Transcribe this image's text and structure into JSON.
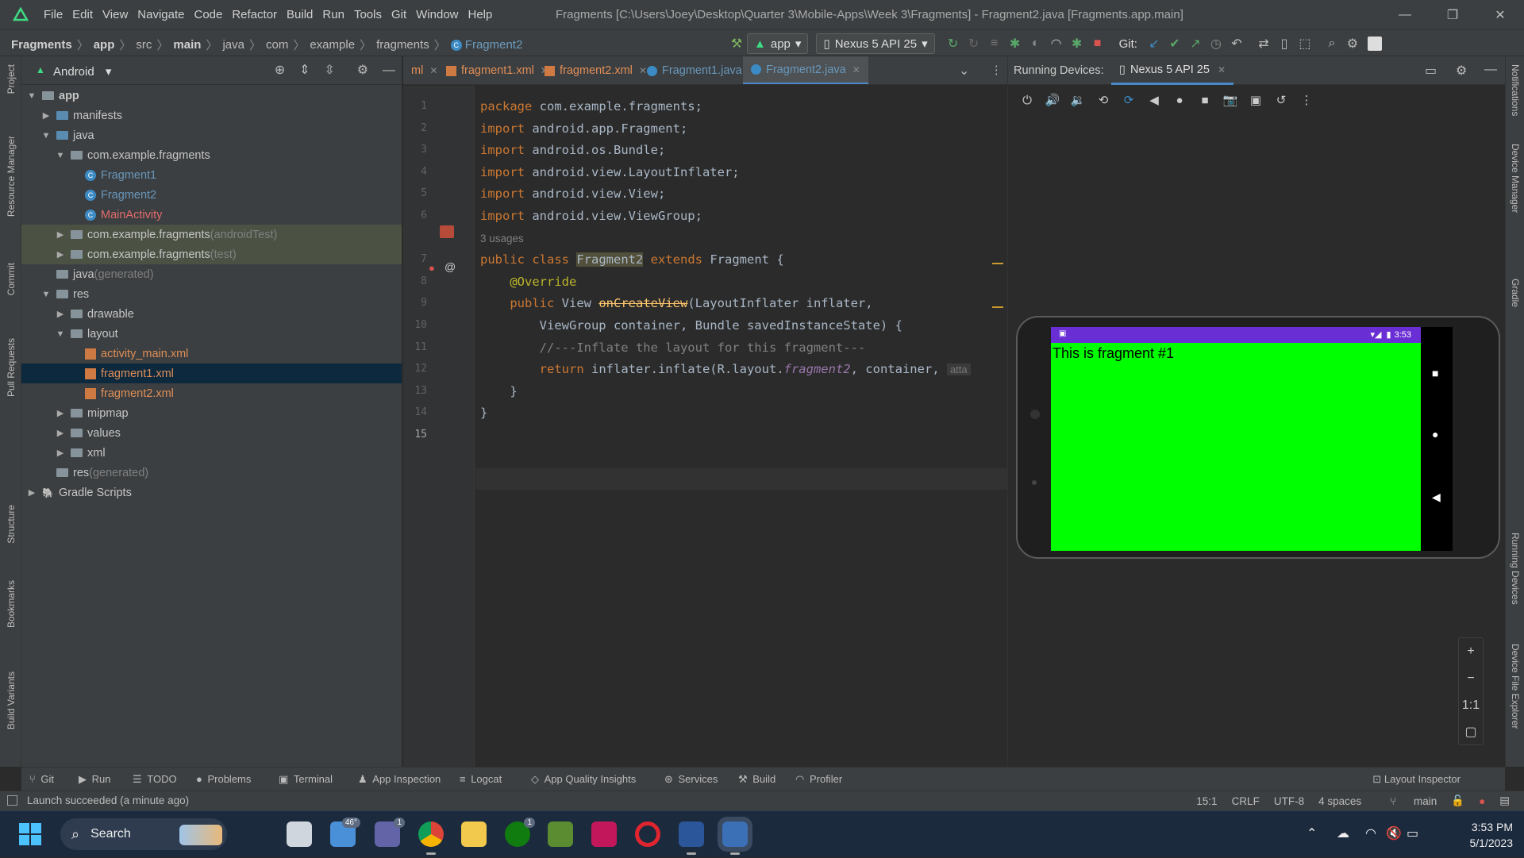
{
  "menu": [
    "File",
    "Edit",
    "View",
    "Navigate",
    "Code",
    "Refactor",
    "Build",
    "Run",
    "Tools",
    "Git",
    "Window",
    "Help"
  ],
  "window_title": "Fragments [C:\\Users\\Joey\\Desktop\\Quarter 3\\Mobile-Apps\\Week 3\\Fragments] - Fragment2.java [Fragments.app.main]",
  "breadcrumbs": [
    "Fragments",
    "app",
    "src",
    "main",
    "java",
    "com",
    "example",
    "fragments",
    "Fragment2"
  ],
  "toolbar": {
    "run_config": "app",
    "device": "Nexus 5 API 25",
    "git_label": "Git:"
  },
  "project_panel": {
    "title": "Android"
  },
  "tree": [
    {
      "label": "app",
      "depth": 0,
      "arrow": "open",
      "icon": "module",
      "bold": true
    },
    {
      "label": "manifests",
      "depth": 1,
      "arrow": "closed",
      "icon": "folder-blue"
    },
    {
      "label": "java",
      "depth": 1,
      "arrow": "open",
      "icon": "folder-blue"
    },
    {
      "label": "com.example.fragments",
      "depth": 2,
      "arrow": "open",
      "icon": "package"
    },
    {
      "label": "Fragment1",
      "depth": 3,
      "icon": "class",
      "color": "java"
    },
    {
      "label": "Fragment2",
      "depth": 3,
      "icon": "class",
      "color": "java"
    },
    {
      "label": "MainActivity",
      "depth": 3,
      "icon": "class",
      "color": "err"
    },
    {
      "label": "com.example.fragments",
      "suffix": " (androidTest)",
      "depth": 2,
      "arrow": "closed",
      "icon": "package",
      "hl": true
    },
    {
      "label": "com.example.fragments",
      "suffix": " (test)",
      "depth": 2,
      "arrow": "closed",
      "icon": "package",
      "hl": true
    },
    {
      "label": "java",
      "suffix": " (generated)",
      "depth": 1,
      "icon": "folder"
    },
    {
      "label": "res",
      "depth": 1,
      "arrow": "open",
      "icon": "folder"
    },
    {
      "label": "drawable",
      "depth": 2,
      "arrow": "closed",
      "icon": "folder"
    },
    {
      "label": "layout",
      "depth": 2,
      "arrow": "open",
      "icon": "folder"
    },
    {
      "label": "activity_main.xml",
      "depth": 3,
      "icon": "xml",
      "color": "xml"
    },
    {
      "label": "fragment1.xml",
      "depth": 3,
      "icon": "xml",
      "color": "xml",
      "sel": true
    },
    {
      "label": "fragment2.xml",
      "depth": 3,
      "icon": "xml",
      "color": "xml"
    },
    {
      "label": "mipmap",
      "depth": 2,
      "arrow": "closed",
      "icon": "folder"
    },
    {
      "label": "values",
      "depth": 2,
      "arrow": "closed",
      "icon": "folder"
    },
    {
      "label": "xml",
      "depth": 2,
      "arrow": "closed",
      "icon": "folder"
    },
    {
      "label": "res",
      "suffix": " (generated)",
      "depth": 1,
      "icon": "folder"
    },
    {
      "label": "Gradle Scripts",
      "depth": 0,
      "arrow": "closed",
      "icon": "gradle"
    }
  ],
  "editor_tabs": [
    {
      "label": "ml",
      "type": "xml"
    },
    {
      "label": "fragment1.xml",
      "type": "xml"
    },
    {
      "label": "fragment2.xml",
      "type": "xml"
    },
    {
      "label": "Fragment1.java",
      "type": "java"
    },
    {
      "label": "Fragment2.java",
      "type": "java",
      "active": true
    }
  ],
  "warnings": "2",
  "code_lines": [
    {
      "n": "1",
      "html": "<span class='kw'>package</span> com.example.fragments;"
    },
    {
      "n": "2",
      "html": "<span class='kw'>import</span> android.app.Fragment;"
    },
    {
      "n": "3",
      "html": "<span class='kw'>import</span> android.os.Bundle;"
    },
    {
      "n": "4",
      "html": "<span class='kw'>import</span> android.view.LayoutInflater;"
    },
    {
      "n": "5",
      "html": "<span class='kw'>import</span> android.view.View;"
    },
    {
      "n": "6",
      "html": "<span class='kw'>import</span> android.view.ViewGroup;"
    },
    {
      "n": "",
      "html": "<span class='usages'>3 usages</span>"
    },
    {
      "n": "7",
      "html": "<span class='kw'>public class</span> <span class='hlw'>Fragment2</span> <span class='kw'>extends</span> Fragment {"
    },
    {
      "n": "8",
      "html": "    <span class='an'>@Override</span>"
    },
    {
      "n": "9",
      "html": "    <span class='kw'>public</span> View <span class='strike'>onCreateView</span>(LayoutInflater inflater,"
    },
    {
      "n": "10",
      "html": "        ViewGroup container, Bundle savedInstanceState) {"
    },
    {
      "n": "11",
      "html": "        <span class='cm'>//---Inflate the layout for this fragment---</span>"
    },
    {
      "n": "12",
      "html": "        <span class='kw'>return</span> inflater.inflate(R.layout.<span class='it'>fragment2</span>, container, <span class='hint'>atta</span>"
    },
    {
      "n": "13",
      "html": "    }"
    },
    {
      "n": "14",
      "html": "}"
    },
    {
      "n": "15",
      "html": ""
    }
  ],
  "devices_panel": {
    "label": "Running Devices:",
    "tab": "Nexus 5 API 25"
  },
  "emulator": {
    "status_time": "3:53",
    "fragment_text": "This is fragment #1"
  },
  "zoom_controls": [
    "+",
    "−",
    "1:1",
    "▢"
  ],
  "left_strip": [
    "Project",
    "Resource Manager",
    "Commit",
    "Pull Requests",
    "Structure",
    "Bookmarks",
    "Build Variants"
  ],
  "right_strip": [
    "Notifications",
    "Device Manager",
    "Gradle",
    "Running Devices",
    "Device File Explorer"
  ],
  "bottom_tabs": [
    "Git",
    "Run",
    "TODO",
    "Problems",
    "Terminal",
    "App Inspection",
    "Logcat",
    "App Quality Insights",
    "Services",
    "Build",
    "Profiler"
  ],
  "layout_inspector": "Layout Inspector",
  "statusbar": {
    "message": "Launch succeeded (a minute ago)",
    "position": "15:1",
    "line_sep": "CRLF",
    "encoding": "UTF-8",
    "indent": "4 spaces",
    "branch": "main"
  },
  "taskbar": {
    "search_label": "Search",
    "weather_badge": "46°",
    "teams_badge": "1",
    "xbox_badge": "1",
    "time": "3:53 PM",
    "date": "5/1/2023"
  },
  "colors": {
    "accent": "#4a88c7",
    "emulator_bg": "#00ff00",
    "status_bar": "#6a2fd4"
  }
}
